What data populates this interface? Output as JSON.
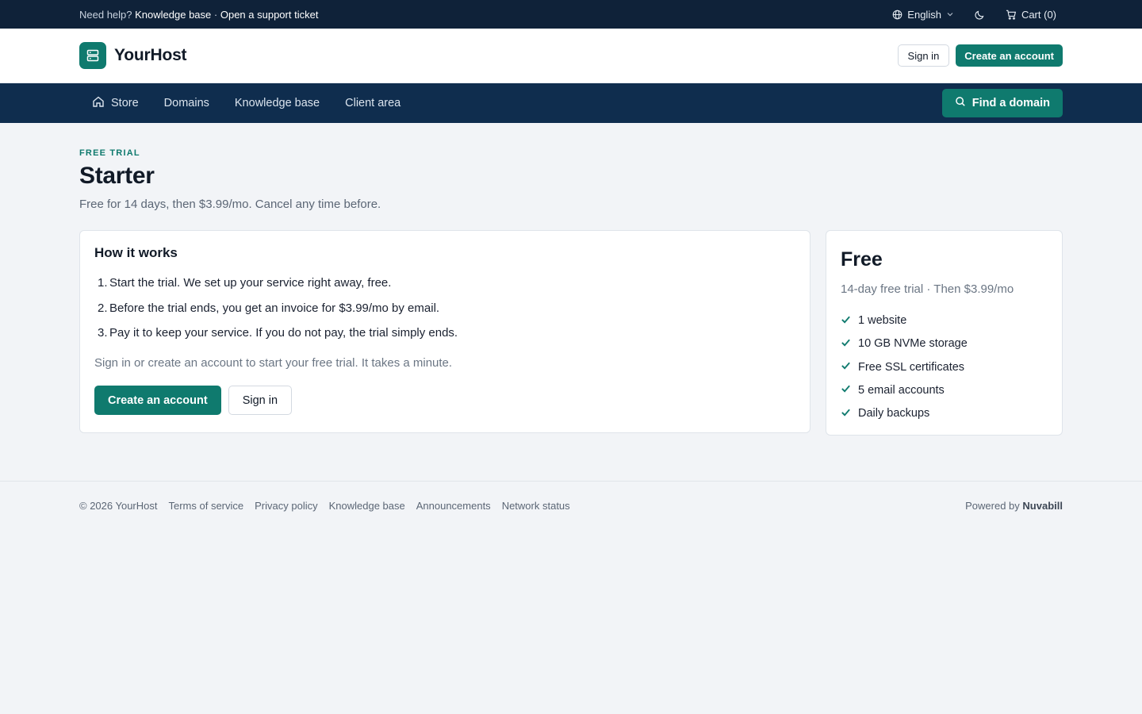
{
  "topbar": {
    "help_prefix": "Need help?",
    "kb_link": "Knowledge base",
    "separator": "·",
    "ticket_link": "Open a support ticket",
    "language": "English",
    "cart": "Cart (0)"
  },
  "header": {
    "brand": "YourHost",
    "sign_in": "Sign in",
    "create_account": "Create an account"
  },
  "nav": {
    "items": [
      "Store",
      "Domains",
      "Knowledge base",
      "Client area"
    ],
    "find_domain": "Find a domain"
  },
  "main": {
    "eyebrow": "FREE TRIAL",
    "title": "Starter",
    "subtitle": "Free for 14 days, then $3.99/mo. Cancel any time before."
  },
  "how_it_works": {
    "title": "How it works",
    "steps": [
      "Start the trial. We set up your service right away, free.",
      "Before the trial ends, you get an invoice for $3.99/mo by email.",
      "Pay it to keep your service. If you do not pay, the trial simply ends."
    ],
    "hint": "Sign in or create an account to start your free trial. It takes a minute.",
    "create_account": "Create an account",
    "sign_in": "Sign in"
  },
  "plan": {
    "name": "Free",
    "sub": "14-day free trial · Then $3.99/mo",
    "features": [
      "1 website",
      "10 GB NVMe storage",
      "Free SSL certificates",
      "5 email accounts",
      "Daily backups"
    ]
  },
  "footer": {
    "copyright": "© 2026 YourHost",
    "links": [
      "Terms of service",
      "Privacy policy",
      "Knowledge base",
      "Announcements",
      "Network status"
    ],
    "powered_prefix": "Powered by",
    "powered_brand": "Nuvabill"
  },
  "colors": {
    "accent": "#0f7a6e",
    "topbar_bg": "#0f2239",
    "nav_bg": "#0f2d4e",
    "page_bg": "#f2f4f7"
  },
  "icons": {
    "language": "globe-icon",
    "theme": "moon-icon",
    "cart": "cart-icon",
    "logo": "server-icon",
    "store": "home-icon",
    "find": "search-icon",
    "feature": "check-icon"
  }
}
